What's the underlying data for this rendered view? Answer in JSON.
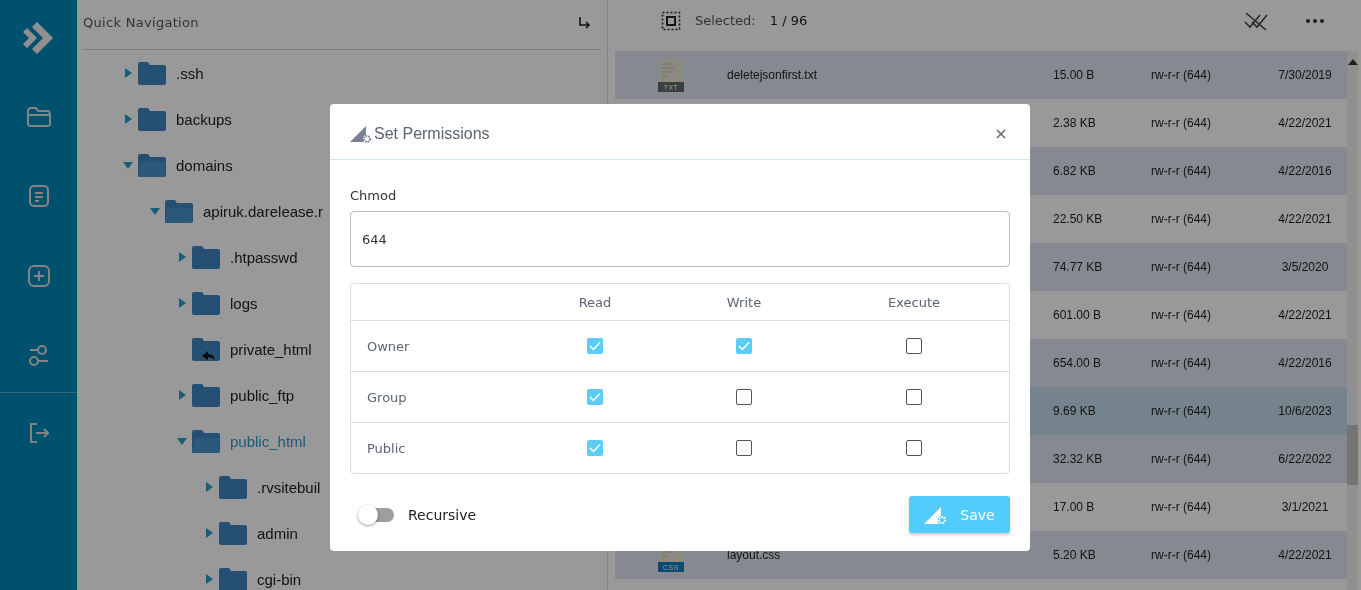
{
  "tree": {
    "title": "Quick Navigation",
    "items": [
      {
        "label": ".ssh",
        "kind": "folder",
        "expanded": false,
        "selected": false
      },
      {
        "label": "backups",
        "kind": "folder",
        "expanded": false,
        "selected": false
      },
      {
        "label": "domains",
        "kind": "folder",
        "expanded": true,
        "selected": false,
        "children": [
          {
            "label": "apiruk.darelease.r",
            "kind": "folder",
            "expanded": true,
            "selected": false,
            "children": [
              {
                "label": ".htpasswd",
                "kind": "folder",
                "expanded": false,
                "selected": false
              },
              {
                "label": "logs",
                "kind": "folder",
                "expanded": false,
                "selected": false
              },
              {
                "label": "private_html",
                "kind": "link",
                "selected": false
              },
              {
                "label": "public_ftp",
                "kind": "folder",
                "expanded": false,
                "selected": false
              },
              {
                "label": "public_html",
                "kind": "folder",
                "expanded": true,
                "selected": true,
                "children": [
                  {
                    "label": ".rvsitebuil",
                    "kind": "folder",
                    "expanded": false,
                    "selected": false
                  },
                  {
                    "label": "admin",
                    "kind": "folder",
                    "expanded": false,
                    "selected": false
                  },
                  {
                    "label": "cgi-bin",
                    "kind": "folder",
                    "expanded": false,
                    "selected": false
                  }
                ]
              }
            ]
          }
        ]
      }
    ]
  },
  "toolbar": {
    "selected_label": "Selected:",
    "selected_count": "1 / 96"
  },
  "files": [
    {
      "name": "deletejsonfirst.txt",
      "badge": "TXT",
      "size": "15.00 B",
      "permissions": "rw-r-r (644)",
      "modified": "7/30/2019",
      "selected": false
    },
    {
      "size": "2.38 KB",
      "permissions": "rw-r-r (644)",
      "modified": "4/22/2021",
      "selected": false
    },
    {
      "size": "6.82 KB",
      "permissions": "rw-r-r (644)",
      "modified": "4/22/2016",
      "selected": false
    },
    {
      "size": "22.50 KB",
      "permissions": "rw-r-r (644)",
      "modified": "4/22/2021",
      "selected": false
    },
    {
      "size": "74.77 KB",
      "permissions": "rw-r-r (644)",
      "modified": "3/5/2020",
      "selected": false
    },
    {
      "size": "601.00 B",
      "permissions": "rw-r-r (644)",
      "modified": "4/22/2021",
      "selected": false
    },
    {
      "size": "654.00 B",
      "permissions": "rw-r-r (644)",
      "modified": "4/22/2016",
      "selected": false
    },
    {
      "size": "9.69 KB",
      "permissions": "rw-r-r (644)",
      "modified": "10/6/2023",
      "selected": true
    },
    {
      "size": "32.32 KB",
      "permissions": "rw-r-r (644)",
      "modified": "6/22/2022",
      "selected": false
    },
    {
      "size": "17.00 B",
      "permissions": "rw-r-r (644)",
      "modified": "3/1/2021",
      "selected": false
    },
    {
      "name": "layout.css",
      "badge": "CSS",
      "size": "5.20 KB",
      "permissions": "rw-r-r (644)",
      "modified": "4/22/2021",
      "selected": false
    }
  ],
  "dialog": {
    "title": "Set Permissions",
    "field_label": "Chmod",
    "value": "644",
    "columns": [
      "Read",
      "Write",
      "Execute"
    ],
    "rows": [
      {
        "label": "Owner",
        "read": true,
        "write": true,
        "execute": false
      },
      {
        "label": "Group",
        "read": true,
        "write": false,
        "execute": false
      },
      {
        "label": "Public",
        "read": true,
        "write": false,
        "execute": false
      }
    ],
    "recursive": {
      "label": "Recursive",
      "on": false
    },
    "save_label": "Save"
  }
}
